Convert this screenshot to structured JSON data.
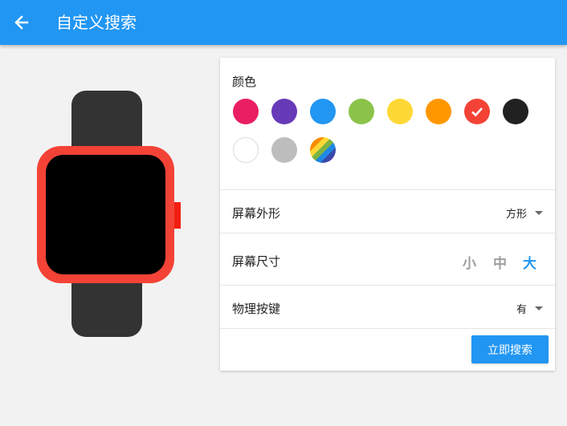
{
  "appbar": {
    "title": "自定义搜索",
    "back_icon": "arrow-left-icon",
    "color": "#2196f3"
  },
  "watch": {
    "case_color": "#f44336",
    "strap_color": "#333333",
    "screen_color": "#000000",
    "crown_color": "#f21e10",
    "shape": "方形"
  },
  "panel": {
    "color_title": "颜色",
    "colors": [
      {
        "name": "pink",
        "hex": "#e91e63"
      },
      {
        "name": "purple",
        "hex": "#673ab7"
      },
      {
        "name": "blue",
        "hex": "#2196f3"
      },
      {
        "name": "green",
        "hex": "#8bc34a"
      },
      {
        "name": "yellow",
        "hex": "#fdd835"
      },
      {
        "name": "orange",
        "hex": "#ff9800"
      },
      {
        "name": "red",
        "hex": "#f44336",
        "selected": true
      },
      {
        "name": "black",
        "hex": "#212121"
      },
      {
        "name": "white",
        "hex": "#ffffff"
      },
      {
        "name": "gray",
        "hex": "#bdbdbd"
      },
      {
        "name": "rainbow",
        "hex": "multicolor"
      }
    ],
    "shape_label": "屏幕外形",
    "shape_value": "方形",
    "size_label": "屏幕尺寸",
    "size_options": [
      {
        "label": "小",
        "selected": false
      },
      {
        "label": "中",
        "selected": false
      },
      {
        "label": "大",
        "selected": true
      }
    ],
    "button_label": "物理按键",
    "button_value": "有",
    "search_button": "立即搜索"
  }
}
